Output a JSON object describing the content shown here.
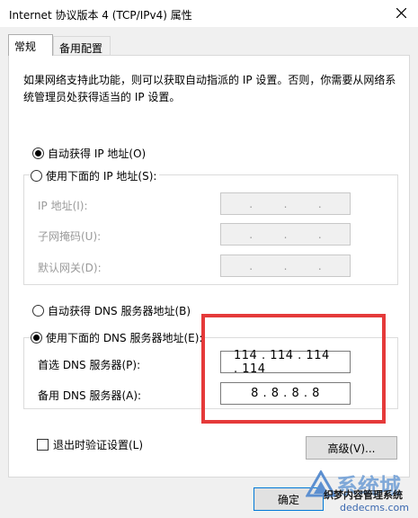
{
  "window": {
    "title": "Internet 协议版本 4 (TCP/IPv4) 属性"
  },
  "tabs": [
    "常规",
    "备用配置"
  ],
  "description": "如果网络支持此功能，则可以获取自动指派的 IP 设置。否则，你需要从网络系统管理员处获得适当的 IP 设置。",
  "ip": {
    "auto_label": "自动获得 IP 地址(O)",
    "manual_label": "使用下面的 IP 地址(S):",
    "selected": "auto",
    "fields": [
      {
        "label": "IP 地址(I):"
      },
      {
        "label": "子网掩码(U):"
      },
      {
        "label": "默认网关(D):"
      }
    ]
  },
  "dns": {
    "auto_label": "自动获得 DNS 服务器地址(B)",
    "manual_label": "使用下面的 DNS 服务器地址(E):",
    "selected": "manual",
    "preferred_label": "首选 DNS 服务器(P):",
    "preferred_value": "114 . 114 . 114 . 114",
    "alternate_label": "备用 DNS 服务器(A):",
    "alternate_value": "8  .  8  .  8  .  8"
  },
  "validate_label": "退出时验证设置(L)",
  "advanced_button": "高级(V)...",
  "ok_button": "确定",
  "watermark": {
    "cn": "系统城",
    "sub": "织梦内容管理系统",
    "url": "dedecms.com"
  },
  "colors": {
    "highlight": "#e53a3a"
  }
}
